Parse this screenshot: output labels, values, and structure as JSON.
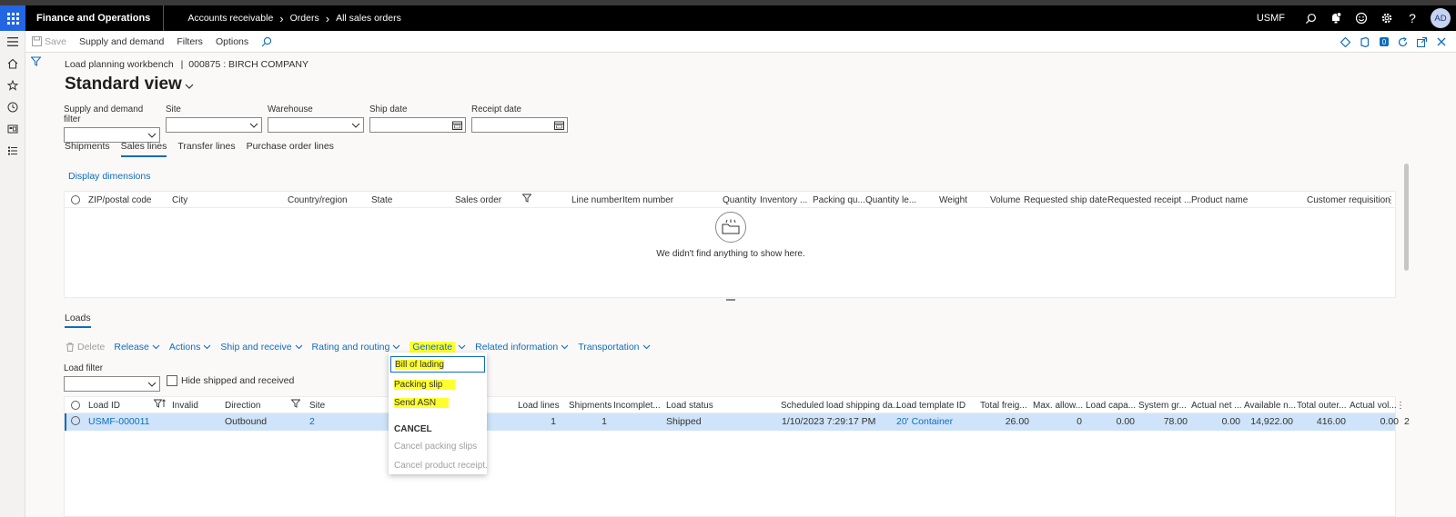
{
  "topbar": {
    "app_name": "Finance and Operations",
    "breadcrumbs": [
      "Accounts receivable",
      "Orders",
      "All sales orders"
    ],
    "company": "USMF",
    "user_initials": "AD"
  },
  "actionbar": {
    "save": "Save",
    "items": [
      "Supply and demand",
      "Filters",
      "Options"
    ]
  },
  "page": {
    "caption": "Load planning workbench",
    "caption_separator": "|",
    "record": "000875 : BIRCH COMPANY",
    "view_title": "Standard view"
  },
  "filters": {
    "supply_demand": "Supply and demand filter",
    "site": "Site",
    "warehouse": "Warehouse",
    "ship_date": "Ship date",
    "receipt_date": "Receipt date"
  },
  "tabs": [
    "Shipments",
    "Sales lines",
    "Transfer lines",
    "Purchase order lines"
  ],
  "lines": {
    "display_dimensions": "Display dimensions",
    "columns": [
      "ZIP/postal code",
      "City",
      "Country/region",
      "State",
      "Sales order",
      "Line number",
      "Item number",
      "Quantity",
      "Inventory ...",
      "Packing qu...",
      "Quantity le...",
      "Weight",
      "Volume",
      "Requested ship date",
      "Requested receipt ...",
      "Product name",
      "Customer requisition"
    ],
    "empty_text": "We didn't find anything to show here."
  },
  "loads": {
    "label": "Loads",
    "toolbar": [
      "Delete",
      "Release",
      "Actions",
      "Ship and receive",
      "Rating and routing",
      "Generate",
      "Related information",
      "Transportation"
    ],
    "load_filter": "Load filter",
    "hide_shipped": "Hide shipped and received",
    "columns": [
      "Load ID",
      "Invalid",
      "Direction",
      "Site",
      "Load lines",
      "Shipments",
      "Incomplet...",
      "Load status",
      "Scheduled load shipping da...",
      "Load template ID",
      "Total freig...",
      "Max. allow...",
      "Load capa...",
      "System gr...",
      "Actual net ...",
      "Available n...",
      "Total outer...",
      "Actual vol..."
    ],
    "row": {
      "load_id": "USMF-000011",
      "direction": "Outbound",
      "site": "2",
      "load_lines": "1",
      "shipments": "1",
      "status": "Shipped",
      "ship_date": "1/10/2023 7:29:17 PM",
      "template": "20' Container",
      "total_freight": "26.00",
      "max_allow": "0",
      "load_capa": "0.00",
      "system_gr": "78.00",
      "actual_net": "0.00",
      "available_n": "14,922.00",
      "total_outer": "416.00",
      "actual_vol": "0.00",
      "overflow": "2"
    }
  },
  "generate_menu": {
    "items": [
      "Bill of lading",
      "Packing slip",
      "Send ASN"
    ],
    "cancel_header": "CANCEL",
    "cancel_items": [
      "Cancel packing slips",
      "Cancel product receipt."
    ]
  },
  "colors": {
    "accent": "#0f6cbd",
    "highlight": "#ffff2e",
    "waffle": "#2266e3"
  }
}
